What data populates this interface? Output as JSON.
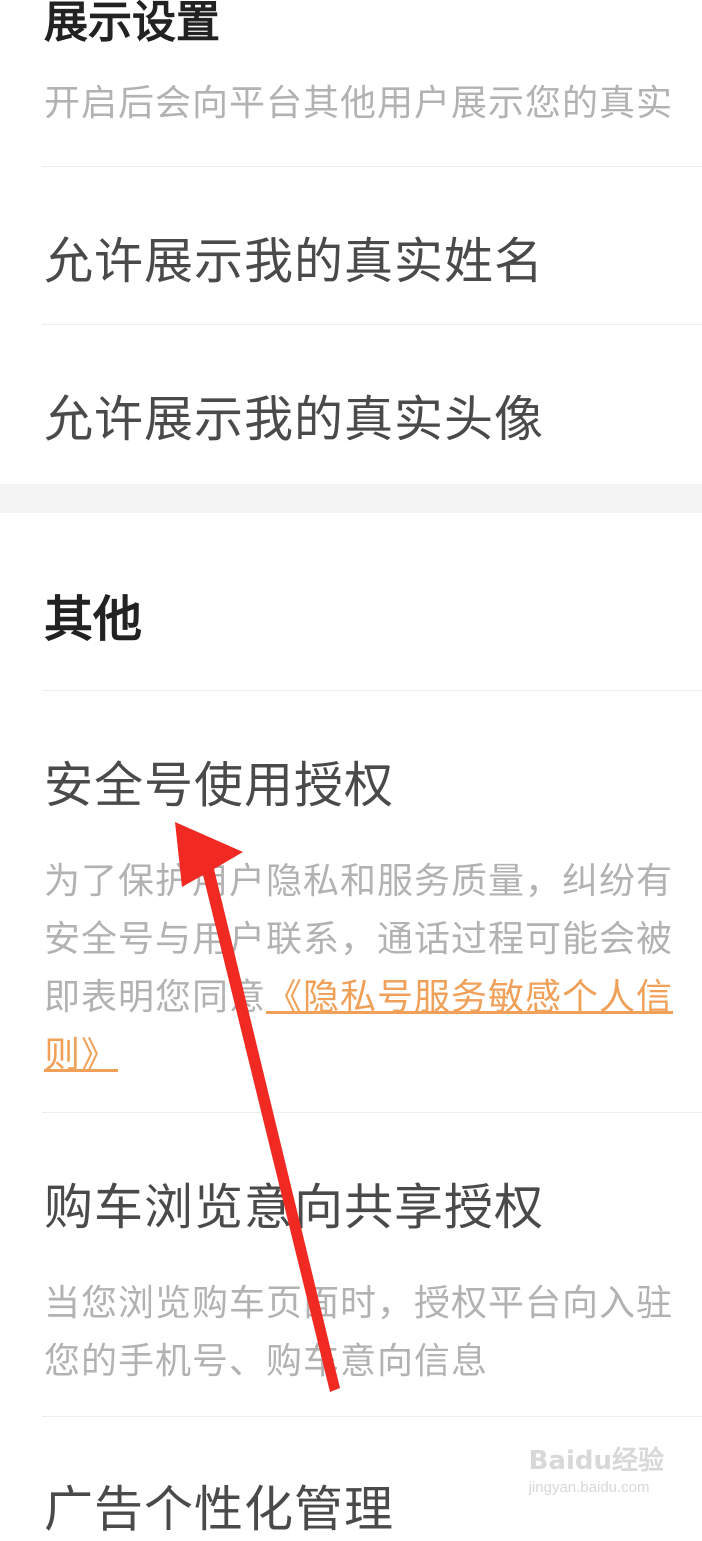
{
  "display_settings": {
    "title": "展示设置",
    "description": "开启后会向平台其他用户展示您的真实",
    "items": [
      {
        "label": "允许展示我的真实姓名"
      },
      {
        "label": "允许展示我的真实头像"
      }
    ]
  },
  "other": {
    "title": "其他",
    "security_number": {
      "label": "安全号使用授权",
      "desc_line1": "为了保护用户隐私和服务质量，纠纷有",
      "desc_line2": "安全号与用户联系，通话过程可能会被",
      "desc_line3_prefix": "即表明您同意",
      "link_line1": "《隐私号服务敏感个人信",
      "link_line2": "则》"
    },
    "browse_intent": {
      "label": "购车浏览意向共享授权",
      "desc_line1": "当您浏览购车页面时，授权平台向入驻",
      "desc_line2": "您的手机号、购车意向信息"
    },
    "ad_personalization": {
      "label": "广告个性化管理"
    }
  },
  "watermark": {
    "logo": "Baidu经验",
    "url": "jingyan.baidu.com"
  },
  "colors": {
    "link": "#f0a058",
    "annotation_arrow": "#f02a23",
    "section_gap": "#f4f4f4"
  }
}
